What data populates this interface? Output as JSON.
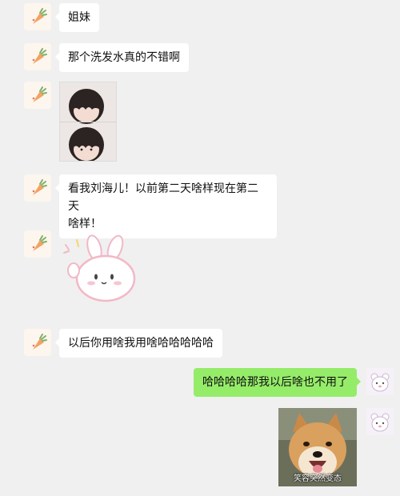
{
  "chat": {
    "messages": [
      {
        "side": "left",
        "type": "text",
        "text": "姐妹"
      },
      {
        "side": "left",
        "type": "text",
        "text": "那个洗发水真的不错啊"
      },
      {
        "side": "left",
        "type": "image",
        "description_icon": "bangs-photo-icon"
      },
      {
        "side": "left",
        "type": "text",
        "line1": "看我刘海儿！以前第二天啥样现在第二天",
        "line2": "啥样！"
      },
      {
        "side": "left",
        "type": "sticker",
        "description_icon": "bunny-sticker-icon"
      },
      {
        "side": "left",
        "type": "text",
        "text": "以后你用啥我用啥哈哈哈哈哈"
      },
      {
        "side": "right",
        "type": "text",
        "text": "哈哈哈哈那我以后啥也不用了"
      },
      {
        "side": "right",
        "type": "sticker",
        "caption": "笑容突然变态",
        "description_icon": "shiba-dog-meme-icon"
      }
    ]
  },
  "colors": {
    "background": "#f0f0f0",
    "incoming_bubble": "#ffffff",
    "outgoing_bubble": "#95ec69"
  }
}
